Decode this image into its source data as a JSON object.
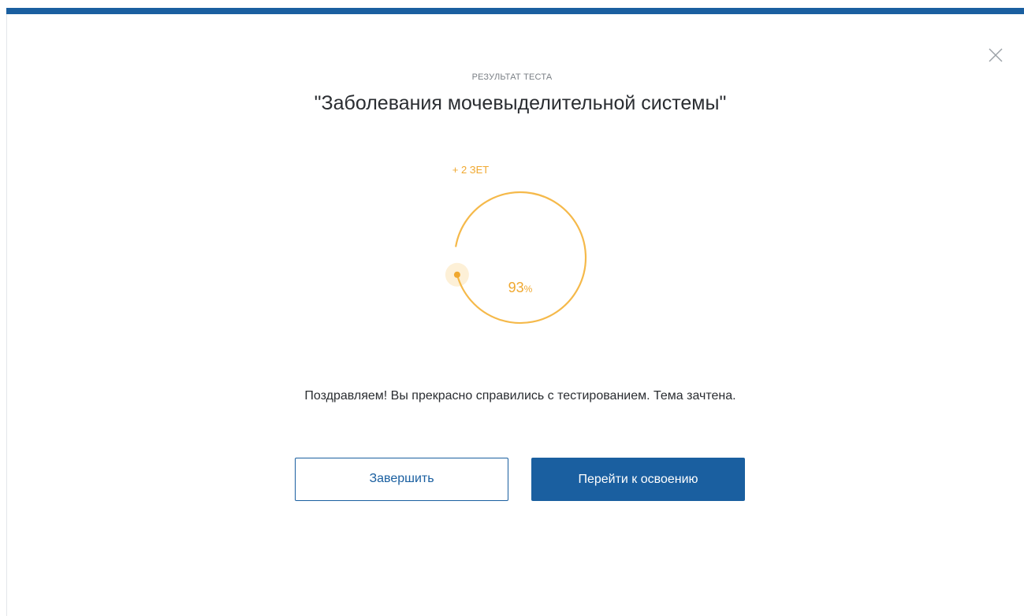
{
  "colors": {
    "primary": "#1a5fa0",
    "accent": "#f0a82f",
    "text": "#2a2d31",
    "muted": "#7a7f85"
  },
  "modal": {
    "subtitle": "РЕЗУЛЬТАТ ТЕСТА",
    "title": "\"Заболевания мочевыделительной системы\"",
    "close_icon": "close-icon"
  },
  "result": {
    "credit": "+ 2 ЗЕТ",
    "percent_value": "93",
    "percent_symbol": "%",
    "progress_fraction": 0.93
  },
  "message": "Поздравляем! Вы прекрасно справились с тестированием. Тема зачтена.",
  "buttons": {
    "finish_label": "Завершить",
    "go_label": "Перейти к освоению"
  }
}
